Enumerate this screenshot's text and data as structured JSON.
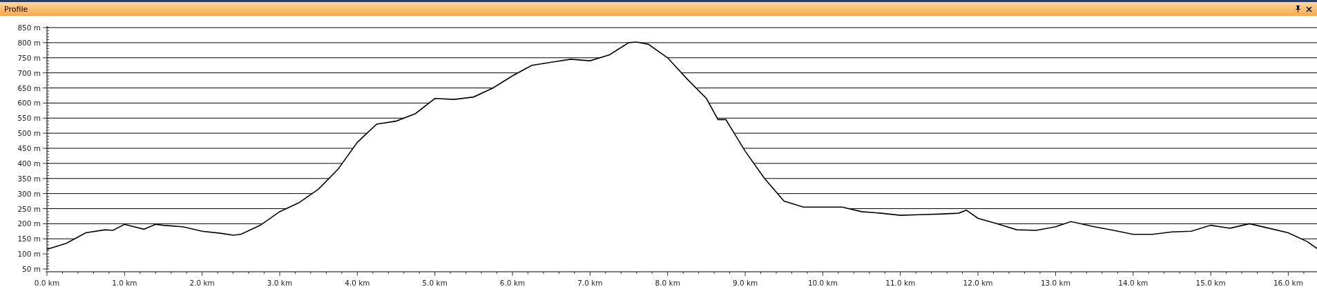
{
  "panel": {
    "title": "Profile",
    "buttons": [
      {
        "kind": "pin"
      },
      {
        "kind": "close"
      }
    ]
  },
  "chart_data": {
    "type": "area",
    "xlim": [
      0,
      16.37
    ],
    "ylim": [
      50,
      850
    ],
    "x": [
      0,
      0.25,
      0.5,
      0.75,
      0.85,
      1.0,
      1.25,
      1.4,
      1.5,
      1.75,
      2.0,
      2.25,
      2.4,
      2.5,
      2.75,
      3.0,
      3.25,
      3.5,
      3.75,
      4.0,
      4.25,
      4.5,
      4.75,
      5.0,
      5.25,
      5.5,
      5.75,
      6.0,
      6.25,
      6.5,
      6.75,
      7.0,
      7.25,
      7.5,
      7.6,
      7.75,
      8.0,
      8.25,
      8.5,
      8.65,
      8.75,
      9.0,
      9.25,
      9.5,
      9.75,
      10.0,
      10.25,
      10.5,
      10.75,
      11.0,
      11.25,
      11.5,
      11.75,
      11.85,
      12.0,
      12.25,
      12.5,
      12.75,
      13.0,
      13.2,
      13.5,
      13.75,
      14.0,
      14.25,
      14.5,
      14.75,
      15.0,
      15.25,
      15.5,
      15.75,
      16.0,
      16.25,
      16.37
    ],
    "grid": true,
    "series": [
      {
        "color": "#000000",
        "values": [
          115,
          135,
          170,
          180,
          178,
          198,
          182,
          198,
          195,
          190,
          175,
          168,
          162,
          165,
          195,
          240,
          270,
          315,
          380,
          470,
          530,
          540,
          565,
          615,
          612,
          620,
          650,
          690,
          725,
          735,
          745,
          740,
          760,
          800,
          802,
          795,
          750,
          680,
          615,
          545,
          545,
          440,
          350,
          275,
          255,
          255,
          255,
          240,
          235,
          228,
          230,
          232,
          235,
          245,
          218,
          200,
          180,
          178,
          190,
          207,
          190,
          178,
          165,
          165,
          173,
          175,
          195,
          185,
          200,
          185,
          170,
          140,
          118
        ]
      }
    ],
    "xticks": [
      {
        "value": 0,
        "label": "0.0 km"
      },
      {
        "value": 1,
        "label": "1.0 km"
      },
      {
        "value": 2,
        "label": "2.0 km"
      },
      {
        "value": 3,
        "label": "3.0 km"
      },
      {
        "value": 4,
        "label": "4.0 km"
      },
      {
        "value": 5,
        "label": "5.0 km"
      },
      {
        "value": 6,
        "label": "6.0 km"
      },
      {
        "value": 7,
        "label": "7.0 km"
      },
      {
        "value": 8,
        "label": "8.0 km"
      },
      {
        "value": 9,
        "label": "9.0 km"
      },
      {
        "value": 10,
        "label": "10.0 km"
      },
      {
        "value": 11,
        "label": "11.0 km"
      },
      {
        "value": 12,
        "label": "12.0 km"
      },
      {
        "value": 13,
        "label": "13.0 km"
      },
      {
        "value": 14,
        "label": "14.0 km"
      },
      {
        "value": 15,
        "label": "15.0 km"
      },
      {
        "value": 16,
        "label": "16.0 km"
      }
    ],
    "yticks": [
      {
        "value": 50,
        "label": "50 m"
      },
      {
        "value": 100,
        "label": "100 m"
      },
      {
        "value": 150,
        "label": "150 m"
      },
      {
        "value": 200,
        "label": "200 m"
      },
      {
        "value": 250,
        "label": "250 m"
      },
      {
        "value": 300,
        "label": "300 m"
      },
      {
        "value": 350,
        "label": "350 m"
      },
      {
        "value": 400,
        "label": "400 m"
      },
      {
        "value": 450,
        "label": "450 m"
      },
      {
        "value": 500,
        "label": "500 m"
      },
      {
        "value": 550,
        "label": "550 m"
      },
      {
        "value": 600,
        "label": "600 m"
      },
      {
        "value": 650,
        "label": "650 m"
      },
      {
        "value": 700,
        "label": "700 m"
      },
      {
        "value": 750,
        "label": "750 m"
      },
      {
        "value": 800,
        "label": "800 m"
      },
      {
        "value": 850,
        "label": "850 m"
      }
    ]
  }
}
